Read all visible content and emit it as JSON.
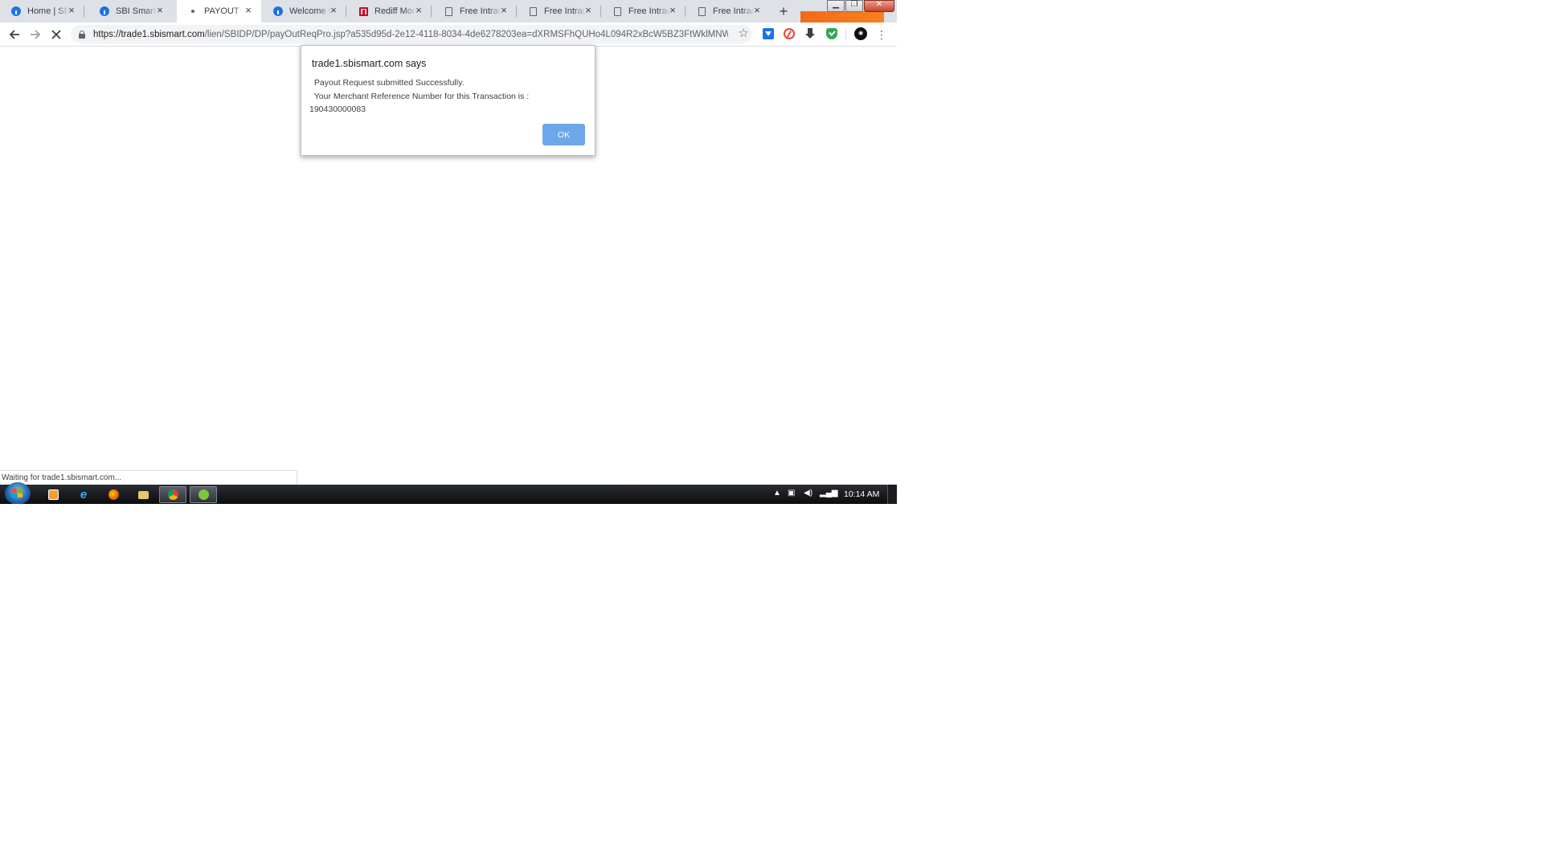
{
  "browser": {
    "tabs": [
      {
        "title": "Home | SBI Smart",
        "icon": "sbi-icon",
        "active": false
      },
      {
        "title": "SBI Smart",
        "icon": "sbi-icon",
        "active": false
      },
      {
        "title": "PAYOUT",
        "icon": "loading-dot-icon",
        "active": true
      },
      {
        "title": "Welcome to SBI",
        "icon": "sbi-icon",
        "active": false
      },
      {
        "title": "Rediff Money",
        "icon": "rediff-icon",
        "active": false
      },
      {
        "title": "Free Intraday",
        "icon": "page-icon",
        "active": false
      },
      {
        "title": "Free Intraday",
        "icon": "page-icon",
        "active": false
      },
      {
        "title": "Free Intraday",
        "icon": "page-icon",
        "active": false
      },
      {
        "title": "Free Intraday",
        "icon": "page-icon",
        "active": false
      }
    ],
    "tab_close_glyph": "×",
    "new_tab_glyph": "+",
    "url_host": "https://trade1.sbismart.com",
    "url_rest": "/lien/SBIDP/DP/payOutReqPro.jsp?a535d95d-2e12-4118-8034-4de6278203ea=dXRMSFhQUHo4L094R2xBcW5BZ3FtWklMNWY..."
  },
  "dialog": {
    "title": "trade1.sbismart.com says",
    "line1": " Payout Request submitted Successfully.",
    "line2": " Your Merchant Reference Number for this Transaction is :",
    "line3": "190430000083",
    "ok_label": "OK",
    "ok_color": "#6ea6ea"
  },
  "status_text": "Waiting for trade1.sbismart.com...",
  "taskbar": {
    "clock": "10:14 AM",
    "apps": [
      "media-player-icon",
      "internet-explorer-icon",
      "firefox-icon",
      "file-explorer-icon",
      "chrome-icon",
      "utorrent-icon"
    ]
  }
}
